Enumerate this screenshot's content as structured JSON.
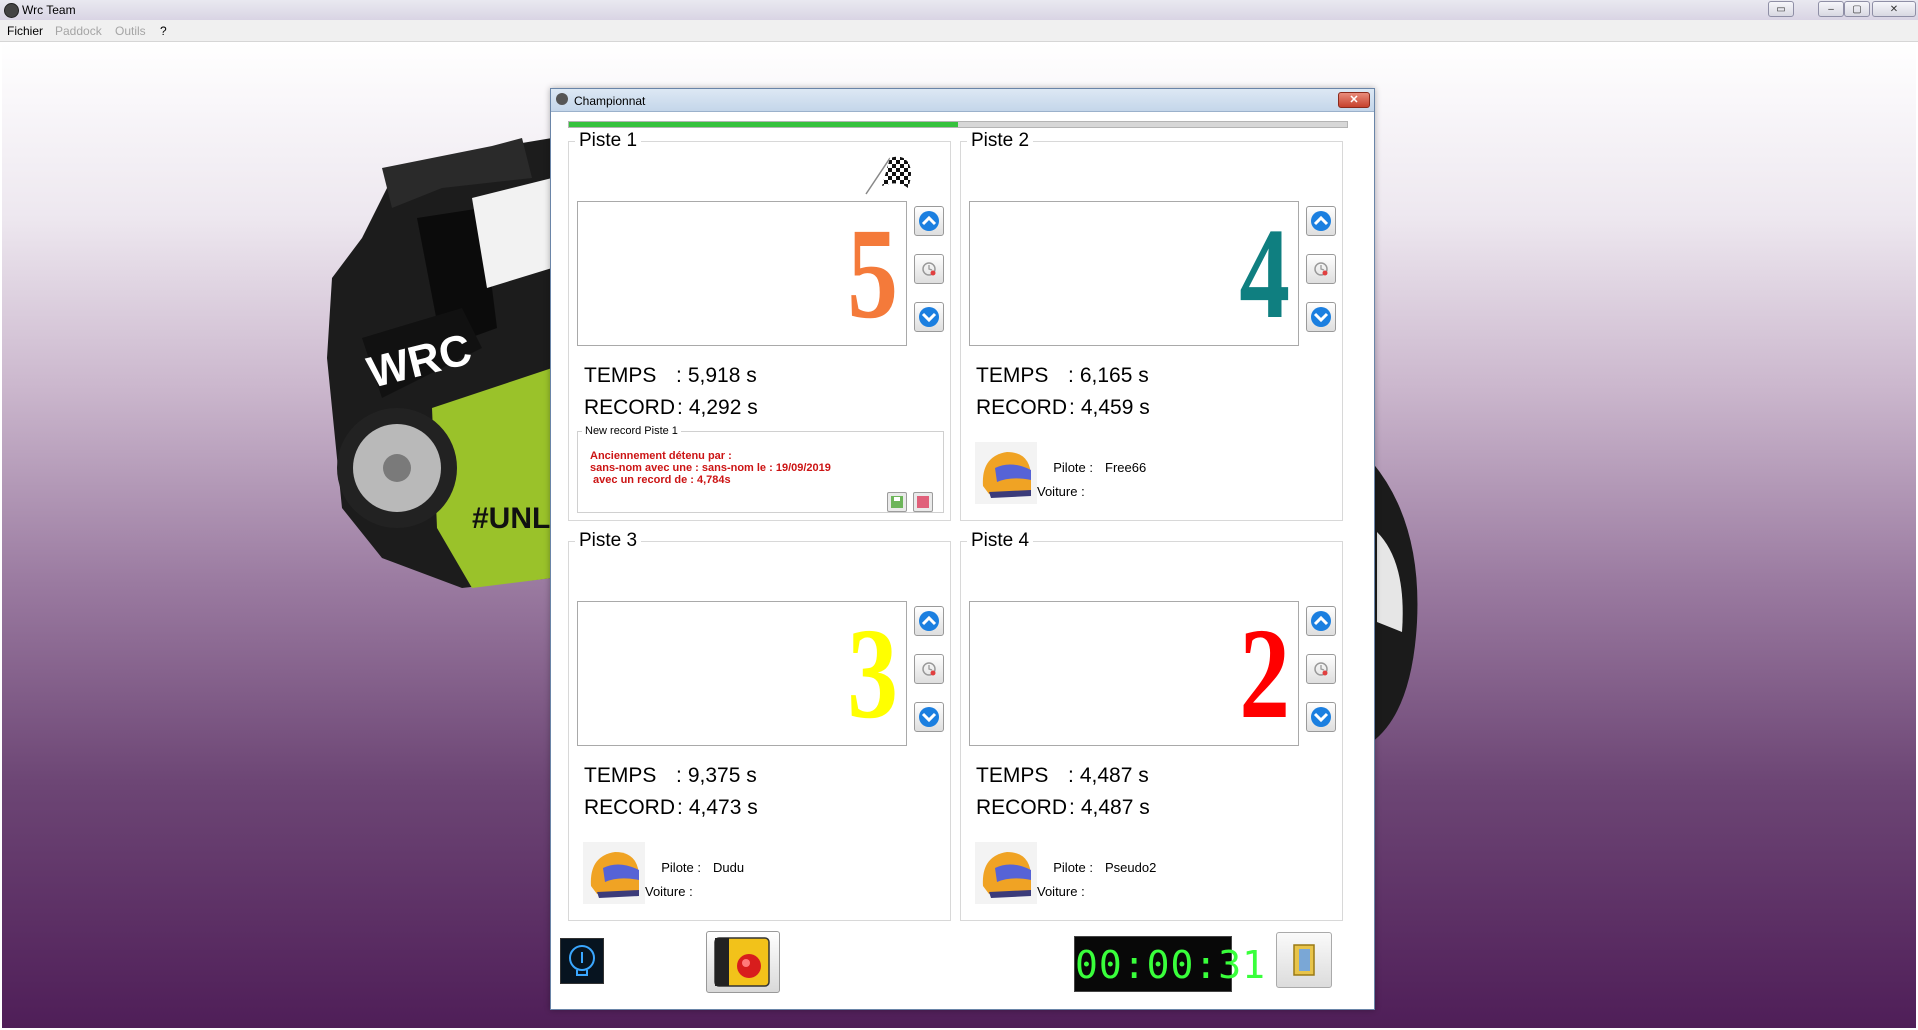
{
  "app": {
    "title": "Wrc Team",
    "window_controls": {
      "restore": "▭",
      "minimize": "–",
      "maximize": "▢",
      "close": "✕"
    }
  },
  "menu": [
    "Fichier",
    "Paddock",
    "Outils",
    "?"
  ],
  "dialog": {
    "title": "Championnat",
    "close": "✕",
    "progress_fraction": 0.5
  },
  "lanes": [
    {
      "title": "Piste 1",
      "number": "5",
      "number_color": "#f47a3a",
      "temps_label": "TEMPS",
      "temps_sep": ":",
      "temps": "5,918 s",
      "record_label": "RECORD",
      "record_sep": ":",
      "record": "4,292 s",
      "new_record": {
        "title": "New record Piste 1",
        "lines": [
          "Anciennement détenu par :",
          "sans-nom avec une : sans-nom le : 19/09/2019",
          " avec un record de : 4,784s"
        ]
      }
    },
    {
      "title": "Piste 2",
      "number": "4",
      "number_color": "#0f7f80",
      "temps_label": "TEMPS",
      "temps_sep": ":",
      "temps": "6,165 s",
      "record_label": "RECORD",
      "record_sep": ":",
      "record": "4,459 s",
      "pilote_label": "Pilote :",
      "pilote": "Free66",
      "voiture_label": "Voiture :",
      "voiture": ""
    },
    {
      "title": "Piste 3",
      "number": "3",
      "number_color": "#ffff00",
      "temps_label": "TEMPS",
      "temps_sep": ":",
      "temps": "9,375 s",
      "record_label": "RECORD",
      "record_sep": ":",
      "record": "4,473 s",
      "pilote_label": "Pilote :",
      "pilote": "Dudu",
      "voiture_label": "Voiture :",
      "voiture": ""
    },
    {
      "title": "Piste 4",
      "number": "2",
      "number_color": "#ff0000",
      "temps_label": "TEMPS",
      "temps_sep": ":",
      "temps": "4,487 s",
      "record_label": "RECORD",
      "record_sep": ":",
      "record": "4,487 s",
      "pilote_label": "Pilote :",
      "pilote": "Pseudo2",
      "voiture_label": "Voiture :",
      "voiture": ""
    }
  ],
  "timer": "00:00:31",
  "icons": {
    "up": "chevron-up-icon",
    "reset": "clock-reset-icon",
    "down": "chevron-down-icon",
    "flag": "checkered-flag-icon",
    "helmet": "helmet-icon",
    "bulb": "lightbulb-icon",
    "emergency": "emergency-stop-icon",
    "exit": "exit-door-icon"
  }
}
